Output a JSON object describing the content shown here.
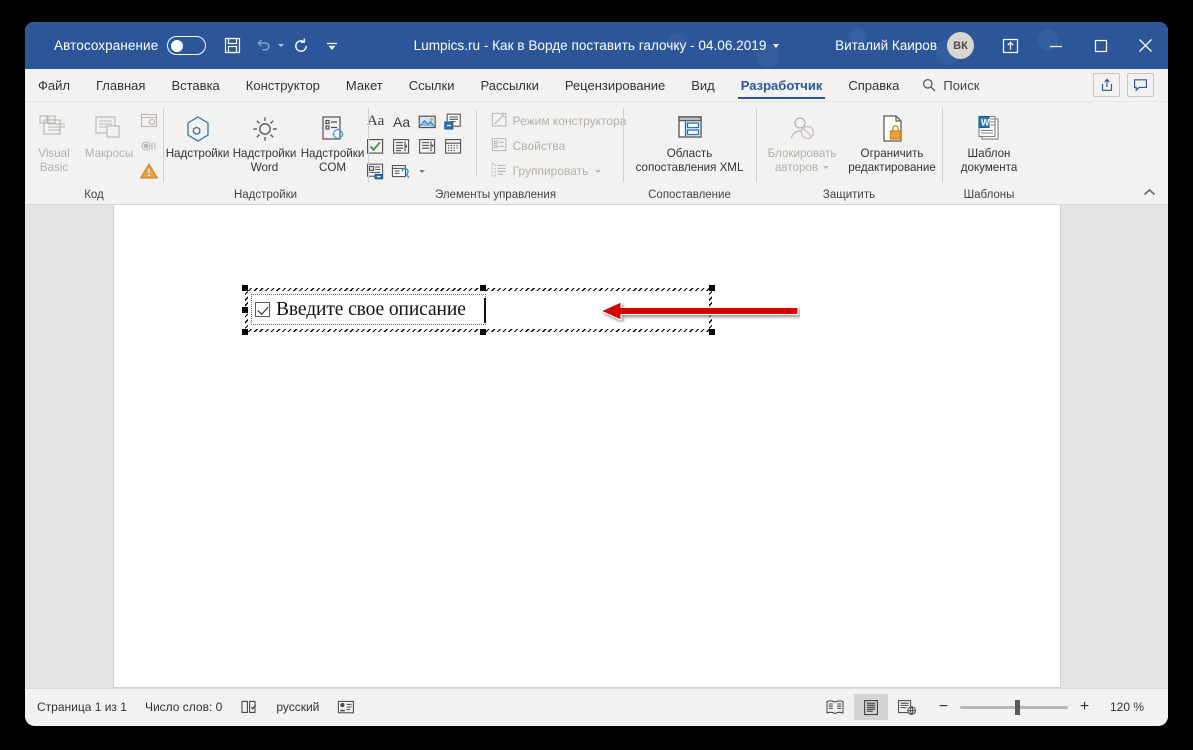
{
  "titlebar": {
    "autosave_label": "Автосохранение",
    "autosave_state": "off",
    "document_title": "Lumpics.ru - Как в Ворде поставить галочку  -  04.06.2019",
    "user_name": "Виталий Каиров",
    "user_initials": "ВК",
    "qat": [
      {
        "name": "save-icon",
        "label": "Сохранить",
        "disabled": false
      },
      {
        "name": "undo-icon",
        "label": "Отменить",
        "disabled": true
      },
      {
        "name": "redo-icon",
        "label": "Вернуть",
        "disabled": false
      },
      {
        "name": "customize-qat-icon",
        "label": "Настройка панели быстрого доступа",
        "disabled": false
      }
    ],
    "window_buttons": [
      {
        "name": "ribbon-display-options-icon",
        "label": "Параметры отображения ленты"
      },
      {
        "name": "minimize-icon",
        "label": "Свернуть"
      },
      {
        "name": "maximize-icon",
        "label": "Развернуть"
      },
      {
        "name": "close-icon",
        "label": "Закрыть"
      }
    ]
  },
  "tabs": [
    {
      "label": "Файл",
      "active": false
    },
    {
      "label": "Главная",
      "active": false
    },
    {
      "label": "Вставка",
      "active": false
    },
    {
      "label": "Конструктор",
      "active": false
    },
    {
      "label": "Макет",
      "active": false
    },
    {
      "label": "Ссылки",
      "active": false
    },
    {
      "label": "Рассылки",
      "active": false
    },
    {
      "label": "Рецензирование",
      "active": false
    },
    {
      "label": "Вид",
      "active": false
    },
    {
      "label": "Разработчик",
      "active": true
    },
    {
      "label": "Справка",
      "active": false
    }
  ],
  "search": {
    "label": "Поиск",
    "placeholder": "Поиск"
  },
  "tabstrip_right": [
    {
      "name": "share-icon",
      "label": "Поделиться"
    },
    {
      "name": "comments-icon",
      "label": "Примечания"
    }
  ],
  "ribbon": {
    "groups": [
      {
        "title": "Код",
        "big_buttons": [
          {
            "label": "Visual\nBasic",
            "line1": "Visual",
            "line2": "Basic",
            "icon": "visual-basic-icon",
            "disabled": true
          },
          {
            "label": "Макросы",
            "line1": "Макросы",
            "line2": "",
            "icon": "macros-icon",
            "disabled": true
          }
        ],
        "small_icons": [
          {
            "name": "record-macro-icon",
            "disabled": true
          },
          {
            "name": "pause-recording-icon",
            "disabled": true
          },
          {
            "name": "macro-security-icon",
            "disabled": false
          }
        ]
      },
      {
        "title": "Надстройки",
        "big_buttons": [
          {
            "label": "Надстройки",
            "line1": "Надстройки",
            "line2": "",
            "icon": "add-ins-icon",
            "disabled": false
          },
          {
            "label": "Надстройки Word",
            "line1": "Надстройки",
            "line2": "Word",
            "icon": "word-add-ins-icon",
            "disabled": false
          },
          {
            "label": "Надстройки COM",
            "line1": "Надстройки",
            "line2": "COM",
            "icon": "com-add-ins-icon",
            "disabled": false
          }
        ]
      },
      {
        "title": "Элементы управления",
        "control_icons": [
          {
            "name": "rich-text-content-control-icon",
            "glyph": "Aa"
          },
          {
            "name": "plain-text-content-control-icon",
            "glyph": "Aa"
          },
          {
            "name": "picture-content-control-icon",
            "glyph": "picture"
          },
          {
            "name": "building-block-gallery-icon",
            "glyph": "gallery"
          },
          {
            "name": "check-box-content-control-icon",
            "glyph": "checkbox"
          },
          {
            "name": "combo-box-content-control-icon",
            "glyph": "combobox"
          },
          {
            "name": "drop-down-list-content-control-icon",
            "glyph": "dropdown"
          },
          {
            "name": "date-picker-content-control-icon",
            "glyph": "datepicker"
          },
          {
            "name": "repeating-section-content-control-icon",
            "glyph": "repeating"
          },
          {
            "name": "legacy-tools-icon",
            "glyph": "legacy"
          }
        ],
        "side_buttons": [
          {
            "label": "Режим конструктора",
            "icon": "design-mode-icon",
            "disabled": true,
            "has_caret": false
          },
          {
            "label": "Свойства",
            "icon": "properties-icon",
            "disabled": true,
            "has_caret": false
          },
          {
            "label": "Группировать",
            "icon": "group-icon",
            "disabled": true,
            "has_caret": true
          }
        ]
      },
      {
        "title": "Сопоставление",
        "big_buttons": [
          {
            "label": "Область сопоставления XML",
            "line1": "Область",
            "line2": "сопоставления XML",
            "icon": "xml-mapping-pane-icon",
            "disabled": false
          }
        ]
      },
      {
        "title": "Защитить",
        "big_buttons": [
          {
            "label": "Блокировать авторов",
            "line1": "Блокировать",
            "line2": "авторов",
            "icon": "block-authors-icon",
            "disabled": true,
            "has_caret": true
          },
          {
            "label": "Ограничить редактирование",
            "line1": "Ограничить",
            "line2": "редактирование",
            "icon": "restrict-editing-icon",
            "disabled": false
          }
        ]
      },
      {
        "title": "Шаблоны",
        "big_buttons": [
          {
            "label": "Шаблон документа",
            "line1": "Шаблон",
            "line2": "документа",
            "icon": "document-template-icon",
            "disabled": false
          }
        ]
      }
    ],
    "collapse_label": "Свернуть ленту"
  },
  "document": {
    "content_control": {
      "checkbox_checked": true,
      "checkbox_name": "check-box-content-control",
      "text": "Введите свое описание"
    },
    "annotation": {
      "name": "red-arrow-annotation",
      "direction": "left",
      "color": "#d40000"
    }
  },
  "statusbar": {
    "page_info": "Страница 1 из 1",
    "word_count": "Число слов: 0",
    "proofing_icon": "proofing-errors-icon",
    "language": "русский",
    "accessibility_icon": "accessibility-checker-icon",
    "view_buttons": [
      {
        "name": "read-mode-icon",
        "label": "Режим чтения",
        "active": false
      },
      {
        "name": "print-layout-icon",
        "label": "Режим разметки",
        "active": true
      },
      {
        "name": "web-layout-icon",
        "label": "Веб-документ",
        "active": false
      }
    ],
    "zoom_out_label": "−",
    "zoom_in_label": "+",
    "zoom_level": "120 %"
  },
  "colors": {
    "brand_blue": "#2b579a",
    "ribbon_bg": "#f3f2f1",
    "doc_bg": "#e4e4e4",
    "accent_red": "#d40000",
    "icon_blue": "#2e75b6",
    "icon_green": "#4a9a52",
    "icon_orange": "#e8a33d"
  }
}
